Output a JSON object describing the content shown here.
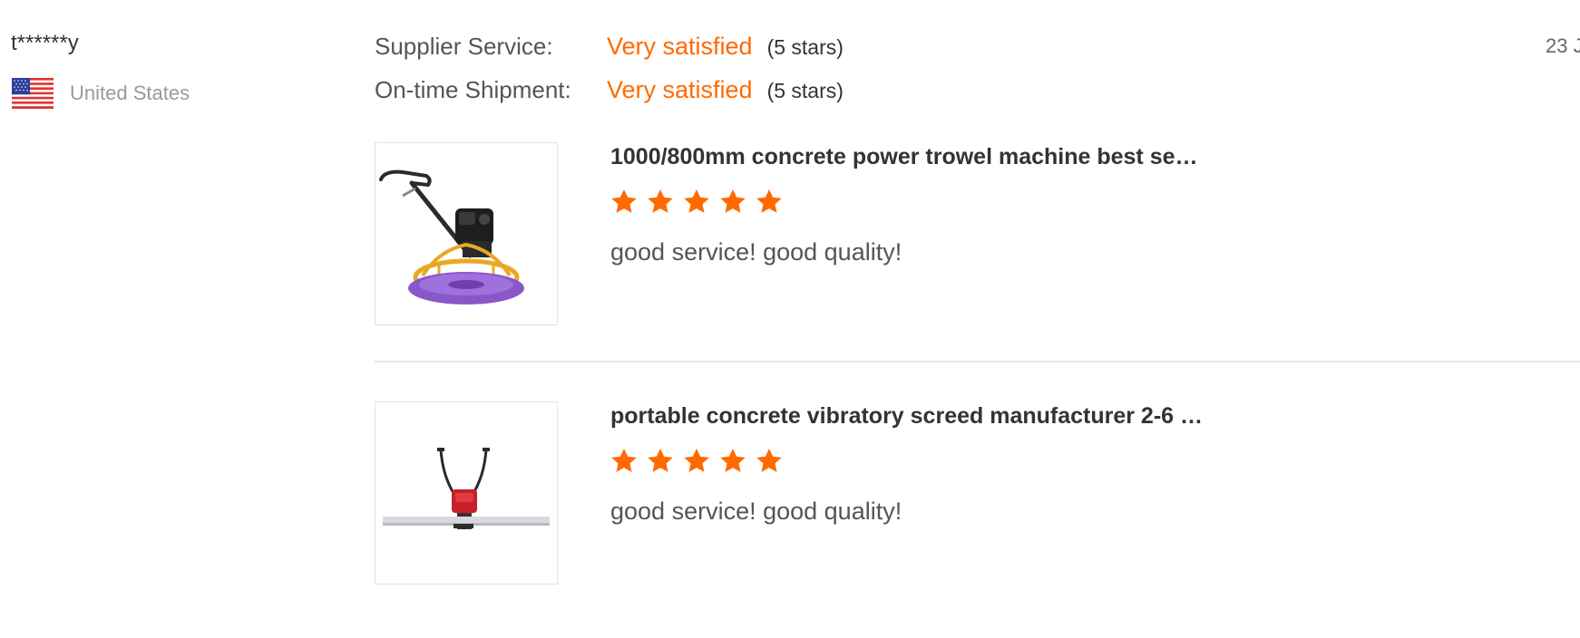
{
  "reviewer": {
    "name": "t******y",
    "country": "United States",
    "flag_icon": "us-flag-icon"
  },
  "review_date": "23 J",
  "ratings": [
    {
      "label": "Supplier Service:",
      "value": "Very satisfied",
      "stars_text": "(5 stars)"
    },
    {
      "label": "On-time Shipment:",
      "value": "Very satisfied",
      "stars_text": "(5 stars)"
    }
  ],
  "products": [
    {
      "title": "1000/800mm concrete power trowel machine best se…",
      "rating": 5,
      "review": "good service! good quality!",
      "image_icon": "power-trowel-machine-image"
    },
    {
      "title": "portable concrete vibratory screed manufacturer 2-6 …",
      "rating": 5,
      "review": "good service! good quality!",
      "image_icon": "vibratory-screed-image"
    }
  ],
  "colors": {
    "accent": "#ff6a00",
    "text_primary": "#333333",
    "text_secondary": "#555555",
    "text_muted": "#999999",
    "divider": "#e6e6e6"
  }
}
